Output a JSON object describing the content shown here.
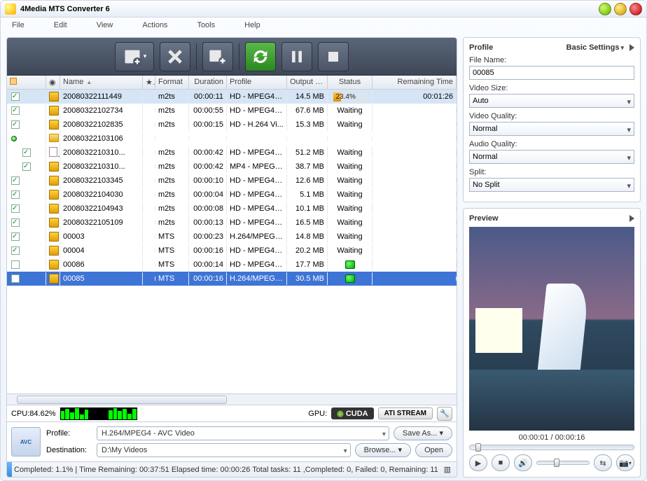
{
  "app_title": "4Media MTS Converter 6",
  "menu": [
    "File",
    "Edit",
    "View",
    "Actions",
    "Tools",
    "Help"
  ],
  "columns": {
    "name": "Name",
    "star": "★",
    "format": "Format",
    "duration": "Duration",
    "profile": "Profile",
    "output_size": "Output Size",
    "status": "Status",
    "remaining": "Remaining Time"
  },
  "rows": [
    {
      "lvl": 0,
      "check": true,
      "icon": "film",
      "name": "20080322111449",
      "fmt": "m2ts",
      "dur": "00:00:11",
      "prof": "HD - MPEG4 Vi...",
      "out": "14.5 MB",
      "status_type": "progress",
      "status_pct": 23.4,
      "status_text": "23.4%",
      "rem": "00:01:26",
      "hl": true
    },
    {
      "lvl": 0,
      "check": true,
      "icon": "film",
      "name": "20080322102734",
      "fmt": "m2ts",
      "dur": "00:00:55",
      "prof": "HD - MPEG4 Vi...",
      "out": "67.6 MB",
      "status_type": "text",
      "status_text": "Waiting",
      "rem": ""
    },
    {
      "lvl": 0,
      "check": true,
      "icon": "film",
      "name": "20080322102835",
      "fmt": "m2ts",
      "dur": "00:00:15",
      "prof": "HD - H.264 Vi...",
      "out": "15.3 MB",
      "status_type": "text",
      "status_text": "Waiting",
      "rem": ""
    },
    {
      "lvl": 0,
      "check": null,
      "icon": "folder",
      "name": "20080322103106",
      "fmt": "",
      "dur": "",
      "prof": "",
      "out": "",
      "status_type": "",
      "status_text": "",
      "rem": "",
      "folder": true,
      "orb": true
    },
    {
      "lvl": 1,
      "check": true,
      "icon": "doc",
      "name": "2008032210310...",
      "fmt": "m2ts",
      "dur": "00:00:42",
      "prof": "HD - MPEG4 Vi...",
      "out": "51.2 MB",
      "status_type": "text",
      "status_text": "Waiting",
      "rem": ""
    },
    {
      "lvl": 1,
      "check": true,
      "icon": "film",
      "name": "2008032210310...",
      "fmt": "m2ts",
      "dur": "00:00:42",
      "prof": "MP4 - MPEG-4...",
      "out": "38.7 MB",
      "status_type": "text",
      "status_text": "Waiting",
      "rem": ""
    },
    {
      "lvl": 0,
      "check": true,
      "icon": "film",
      "name": "20080322103345",
      "fmt": "m2ts",
      "dur": "00:00:10",
      "prof": "HD - MPEG4 Vi...",
      "out": "12.6 MB",
      "status_type": "text",
      "status_text": "Waiting",
      "rem": ""
    },
    {
      "lvl": 0,
      "check": true,
      "icon": "film",
      "name": "20080322104030",
      "fmt": "m2ts",
      "dur": "00:00:04",
      "prof": "HD - MPEG4 Vi...",
      "out": "5.1 MB",
      "status_type": "text",
      "status_text": "Waiting",
      "rem": ""
    },
    {
      "lvl": 0,
      "check": true,
      "icon": "film",
      "name": "20080322104943",
      "fmt": "m2ts",
      "dur": "00:00:08",
      "prof": "HD - MPEG4 Vi...",
      "out": "10.1 MB",
      "status_type": "text",
      "status_text": "Waiting",
      "rem": ""
    },
    {
      "lvl": 0,
      "check": true,
      "icon": "film",
      "name": "20080322105109",
      "fmt": "m2ts",
      "dur": "00:00:13",
      "prof": "HD - MPEG4 Vi...",
      "out": "16.5 MB",
      "status_type": "text",
      "status_text": "Waiting",
      "rem": ""
    },
    {
      "lvl": 0,
      "check": true,
      "icon": "film",
      "name": "00003",
      "fmt": "MTS",
      "dur": "00:00:23",
      "prof": "H.264/MPEG4...",
      "out": "14.8 MB",
      "status_type": "text",
      "status_text": "Waiting",
      "rem": ""
    },
    {
      "lvl": 0,
      "check": true,
      "icon": "film",
      "name": "00004",
      "fmt": "MTS",
      "dur": "00:00:16",
      "prof": "HD - MPEG4 Vi...",
      "out": "20.2 MB",
      "status_type": "text",
      "status_text": "Waiting",
      "rem": ""
    },
    {
      "lvl": 0,
      "check": false,
      "icon": "film",
      "name": "00086",
      "fmt": "MTS",
      "dur": "00:00:14",
      "prof": "HD - MPEG4 Vi...",
      "out": "17.7 MB",
      "status_type": "dot",
      "status_text": "",
      "rem": ""
    },
    {
      "lvl": 0,
      "check": false,
      "icon": "film",
      "name": "00085",
      "fmt": "MTS",
      "dur": "00:00:16",
      "prof": "H.264/MPEG4...",
      "out": "30.5 MB",
      "status_type": "dot",
      "status_text": "",
      "rem": "",
      "sel": true
    }
  ],
  "cpu_label": "CPU:84.62%",
  "gpu_label": "GPU:",
  "gpu_cuda": "CUDA",
  "gpu_ati": "ATI STREAM",
  "profile_label": "Profile:",
  "profile_value": "H.264/MPEG4 - AVC Video",
  "dest_label": "Destination:",
  "dest_value": "D:\\My Videos",
  "btn_save_as": "Save As...",
  "btn_browse": "Browse...",
  "btn_open": "Open",
  "status_text": "Completed: 1.1% | Time Remaining: 00:37:51 Elapsed time: 00:00:26 Total tasks: 11 ,Completed: 0, Failed: 0, Remaining: 11",
  "right": {
    "profile_title": "Profile",
    "basic_settings": "Basic Settings",
    "file_name_label": "File Name:",
    "file_name_value": "00085",
    "video_size_label": "Video Size:",
    "video_size_value": "Auto",
    "video_quality_label": "Video Quality:",
    "video_quality_value": "Normal",
    "audio_quality_label": "Audio Quality:",
    "audio_quality_value": "Normal",
    "split_label": "Split:",
    "split_value": "No Split",
    "preview_title": "Preview",
    "timecode": "00:00:01 / 00:00:16"
  }
}
